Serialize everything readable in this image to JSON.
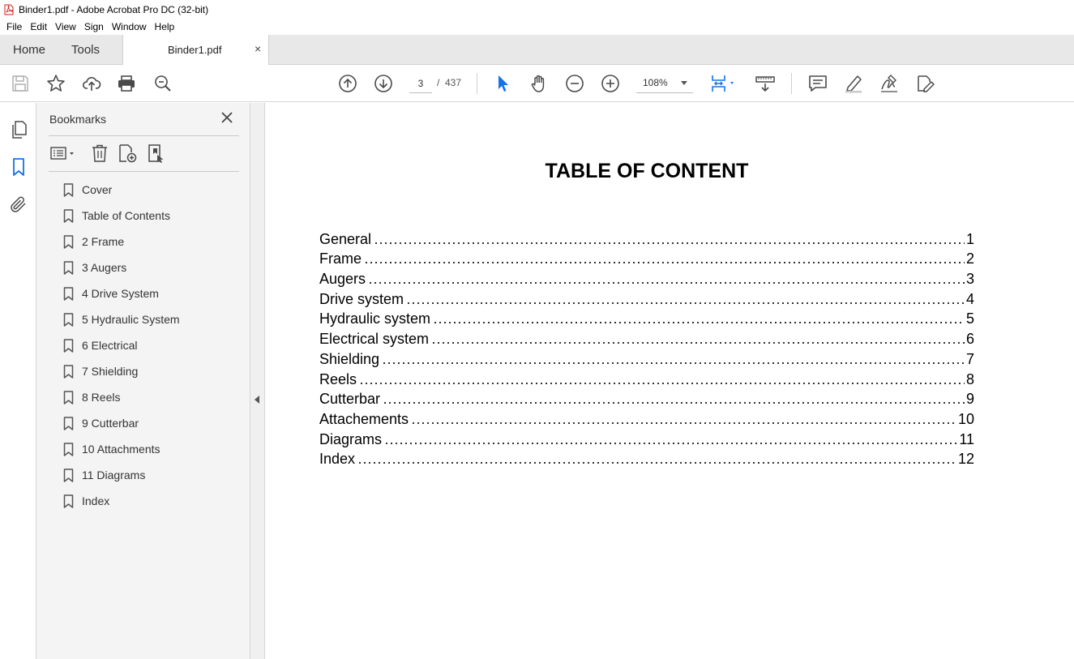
{
  "window": {
    "title": "Binder1.pdf - Adobe Acrobat Pro DC (32-bit)",
    "app_icon": "acrobat-pdf-icon",
    "accent_color": "#cc1f1f"
  },
  "menu": [
    "File",
    "Edit",
    "View",
    "Sign",
    "Window",
    "Help"
  ],
  "tabs": {
    "home": "Home",
    "tools": "Tools",
    "document": "Binder1.pdf",
    "close_glyph": "×"
  },
  "toolbar": {
    "current_page": "3",
    "page_separator": "/",
    "total_pages": "437",
    "zoom": "108%",
    "selection_color": "#1473e6",
    "icons": [
      "save-icon",
      "bookmark-star-icon",
      "upload-cloud-icon",
      "print-icon",
      "search-zoom-icon",
      "previous-page-icon",
      "next-page-icon",
      "select-cursor-icon",
      "hand-tool-icon",
      "zoom-out-icon",
      "zoom-in-icon",
      "page-fit-icon",
      "scrolling-mode-icon",
      "comment-icon",
      "highlight-icon",
      "sign-icon",
      "edit-pdf-icon"
    ]
  },
  "left_rail": [
    "page-thumbnails-icon",
    "bookmarks-icon",
    "attachments-icon"
  ],
  "bookmarks_panel": {
    "header": "Bookmarks",
    "items": [
      "Cover",
      "Table of Contents",
      "2 Frame",
      "3 Augers",
      "4 Drive System",
      "5 Hydraulic System",
      "6 Electrical",
      "7 Shielding",
      "8 Reels",
      "9 Cutterbar",
      "10 Attachments",
      "11 Diagrams",
      "Index"
    ]
  },
  "document": {
    "heading": "TABLE OF CONTENT",
    "toc": [
      {
        "title": "General",
        "page": "1"
      },
      {
        "title": "Frame",
        "page": "2"
      },
      {
        "title": "Augers",
        "page": "3"
      },
      {
        "title": "Drive system",
        "page": "4"
      },
      {
        "title": "Hydraulic system",
        "page": "5"
      },
      {
        "title": "Electrical system",
        "page": "6"
      },
      {
        "title": "Shielding",
        "page": "7"
      },
      {
        "title": "Reels",
        "page": "8"
      },
      {
        "title": "Cutterbar",
        "page": "9"
      },
      {
        "title": "Attachements",
        "page": "10"
      },
      {
        "title": "Diagrams",
        "page": "11"
      },
      {
        "title": "Index",
        "page": "12"
      }
    ]
  }
}
